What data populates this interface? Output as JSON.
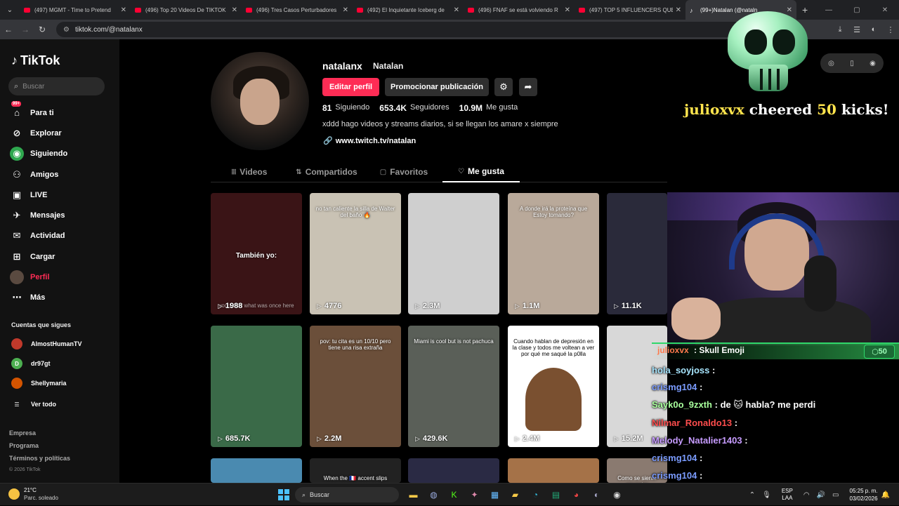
{
  "browser": {
    "tabs": [
      {
        "title": "(497) MGMT - Time to Pretend",
        "type": "yt"
      },
      {
        "title": "(496) Top 20 Videos De TIKTOK",
        "type": "yt"
      },
      {
        "title": "(496) Tres Casos Perturbadores",
        "type": "yt"
      },
      {
        "title": "(492) El Inquietante Iceberg de",
        "type": "yt"
      },
      {
        "title": "(496) FNAF se está volviendo R",
        "type": "yt"
      },
      {
        "title": "(497) TOP 5 INFLUENCERS QUE",
        "type": "yt"
      },
      {
        "title": "(99+)Natalan (@nataln",
        "type": "tt"
      }
    ],
    "url": "tiktok.com/@natalanx"
  },
  "sidebar": {
    "logo": "TikTok",
    "search_placeholder": "Buscar",
    "nav": [
      {
        "label": "Para ti",
        "icon": "⌂"
      },
      {
        "label": "Explorar",
        "icon": "⊘"
      },
      {
        "label": "Siguiendo",
        "icon": "◉"
      },
      {
        "label": "Amigos",
        "icon": "⚇"
      },
      {
        "label": "LIVE",
        "icon": "▣"
      },
      {
        "label": "Mensajes",
        "icon": "✈",
        "badge": "99+"
      },
      {
        "label": "Actividad",
        "icon": "✉",
        "badge": "99+"
      },
      {
        "label": "Cargar",
        "icon": "⊞"
      },
      {
        "label": "Perfil",
        "icon": "●"
      },
      {
        "label": "Más",
        "icon": "⋯"
      }
    ],
    "follows_title": "Cuentas que sigues",
    "follows": [
      {
        "name": "AlmostHumanTV",
        "color": "#c0392b"
      },
      {
        "name": "dr97gt",
        "color": "#4caf50",
        "initial": "D"
      },
      {
        "name": "Shellymaria",
        "color": "#d35400"
      }
    ],
    "see_all": "Ver todo",
    "footer": [
      "Empresa",
      "Programa",
      "Términos y políticas"
    ],
    "copyright": "© 2026 TikTok"
  },
  "profile": {
    "username": "natalanx",
    "nickname": "Natalan",
    "edit_label": "Editar perfil",
    "promote_label": "Promocionar publicación",
    "following_count": "81",
    "following_label": "Siguiendo",
    "followers_count": "653.4K",
    "followers_label": "Seguidores",
    "likes_count": "10.9M",
    "likes_label": "Me gusta",
    "bio": "xddd hago videos y streams diarios, si se llegan los amare x siempre",
    "link": "www.twitch.tv/natalan"
  },
  "profile_tabs": [
    {
      "label": "Videos",
      "icon": "⦙⦙⦙",
      "active": false
    },
    {
      "label": "Compartidos",
      "icon": "⇅",
      "active": false
    },
    {
      "label": "Favoritos",
      "icon": "▢",
      "active": false
    },
    {
      "label": "Me gusta",
      "icon": "♡",
      "active": true
    }
  ],
  "videos": [
    {
      "views": "1988",
      "caption": "También yo:",
      "caption2": "you know what was once here",
      "bg": "#3a1416"
    },
    {
      "views": "4776",
      "caption": "no tan caliente la silla de Walter del baño 🔥",
      "bg": "#c9c2b4"
    },
    {
      "views": "2.3M",
      "caption": "",
      "bg": "#cfcfcf"
    },
    {
      "views": "1.1M",
      "caption": "A donde irá la proteína que Estoy tomando?",
      "bg": "#b9a99a"
    },
    {
      "views": "11.1K",
      "caption": "",
      "bg": "#2a2a3a"
    },
    {
      "views": "685.7K",
      "caption": "",
      "bg": "#3a6a48"
    },
    {
      "views": "2.2M",
      "caption": "pov: tu cita es un 10/10 pero tiene una risa extraña",
      "bg": "#6b4f3a"
    },
    {
      "views": "429.6K",
      "caption": "Miami is cool but is not pachuca",
      "bg": "#5a5f58"
    },
    {
      "views": "2.4M",
      "caption": "Cuando hablan de depresión en la clase y todos me voltean a ver por qué me saqué la p0lla",
      "bg": "#ffffff"
    },
    {
      "views": "15.2M",
      "caption": "",
      "bg": "#d8d8d8"
    },
    {
      "views": "",
      "caption": "",
      "bg": "#4a8ab0"
    },
    {
      "views": "",
      "caption": "When the 🇫🇷 accent slips",
      "bg": "#222"
    },
    {
      "views": "",
      "caption": "",
      "bg": "#2a2a44"
    },
    {
      "views": "",
      "caption": "",
      "bg": "#a57248"
    },
    {
      "views": "",
      "caption": "Como se siente aguantar",
      "bg": "#8a7a70"
    }
  ],
  "overlay": {
    "cheer_user": "julioxvx",
    "cheer_text": "cheered",
    "cheer_amount": "50",
    "cheer_unit": "kicks!",
    "chat_top_user": "julioxvx",
    "chat_top_msg": ": Skull Emoji",
    "chat_top_count": "50",
    "chat": [
      {
        "user": "hola_soyjoss",
        "color": "#a8e6ff",
        "msg": ":"
      },
      {
        "user": "crismg104",
        "color": "#7b9cff",
        "msg": ":"
      },
      {
        "user": "Sayk0o_9zxth",
        "color": "#a8ff9c",
        "msg": ": de 🐱 habla? me perdi"
      },
      {
        "user": "Nilmar_Ronaldo13",
        "color": "#ff4d4d",
        "msg": ":"
      },
      {
        "user": "Melody_Natalier1403",
        "color": "#c79cff",
        "msg": ":"
      },
      {
        "user": "crismg104",
        "color": "#7b9cff",
        "msg": ":"
      },
      {
        "user": "crismg104",
        "color": "#7b9cff",
        "msg": ":"
      }
    ]
  },
  "taskbar": {
    "temp": "21°C",
    "weather": "Parc. soleado",
    "search": "Buscar",
    "lang_top": "ESP",
    "lang_bottom": "LAA",
    "time": "05:25 p. m.",
    "date": "03/02/2026"
  }
}
